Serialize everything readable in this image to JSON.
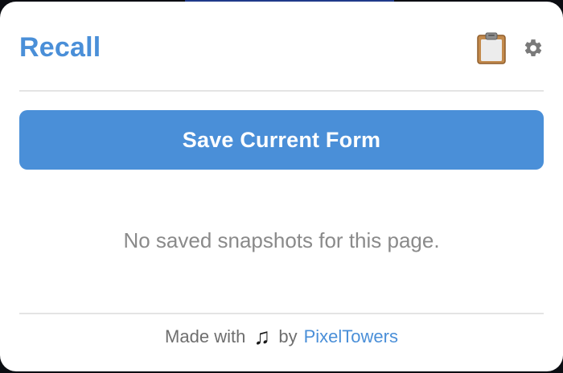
{
  "app": {
    "title": "Recall"
  },
  "header": {
    "icons": [
      "clipboard-icon",
      "gear-icon"
    ]
  },
  "actions": {
    "save_label": "Save Current Form"
  },
  "snapshots": {
    "empty_message": "No saved snapshots for this page."
  },
  "footer": {
    "made_with": "Made with",
    "note_glyph": "♫",
    "by": "by",
    "author": "PixelTowers"
  },
  "colors": {
    "accent": "#4a8fd8",
    "muted_text": "#8a8a8a",
    "divider": "#e4e4e4"
  }
}
